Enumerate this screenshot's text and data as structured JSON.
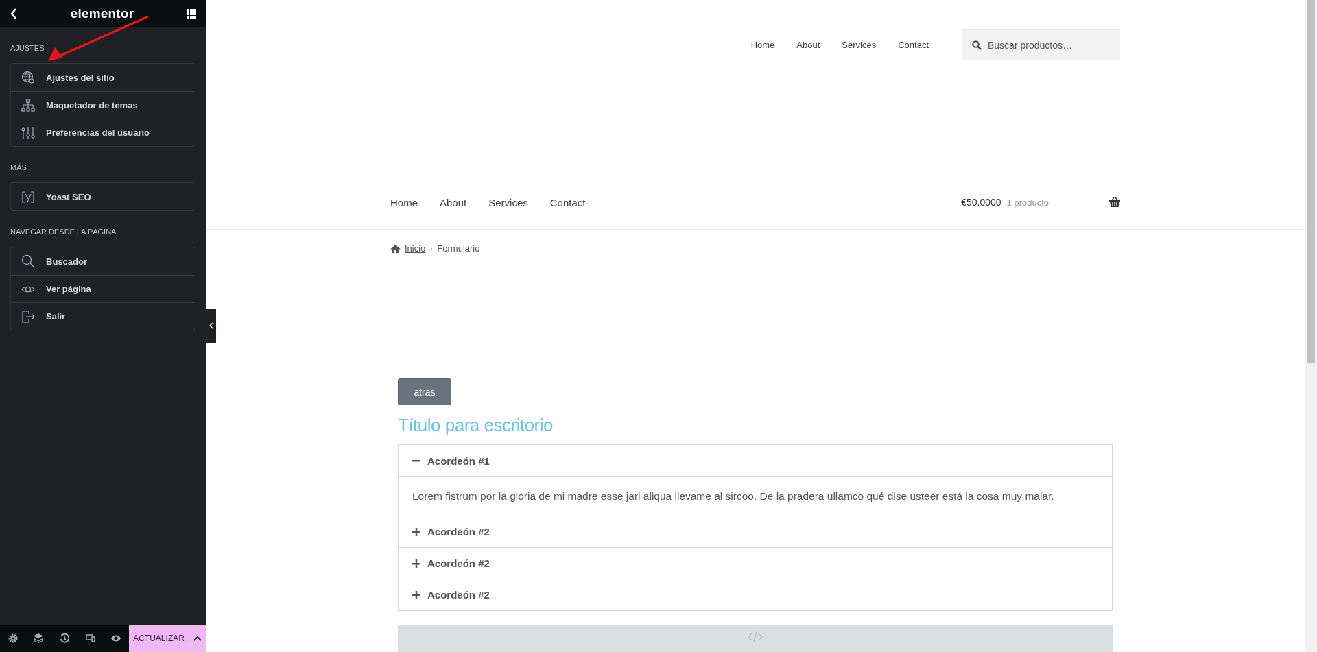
{
  "editor": {
    "logo": "elementor",
    "sections": [
      {
        "title": "AJUSTES",
        "items": [
          {
            "label": "Ajustes del sitio"
          },
          {
            "label": "Maquetador de temas"
          },
          {
            "label": "Preferencias del usuario"
          }
        ]
      },
      {
        "title": "MÁS",
        "items": [
          {
            "label": "Yoast SEO"
          }
        ]
      },
      {
        "title": "NAVEGAR DESDE LA PÁGINA",
        "items": [
          {
            "label": "Buscador"
          },
          {
            "label": "Ver página"
          },
          {
            "label": "Salir"
          }
        ]
      }
    ],
    "update_button": "ACTUALIZAR"
  },
  "site": {
    "top_nav": [
      "Home",
      "About",
      "Services",
      "Contact"
    ],
    "search": {
      "placeholder": "Buscar productos…"
    },
    "main_nav": [
      "Home",
      "About",
      "Services",
      "Contact"
    ],
    "cart": {
      "total": "€50.0000",
      "count": "1 producto"
    },
    "breadcrumb": [
      {
        "label": "Inicio",
        "link": true
      },
      {
        "label": "Formulario",
        "link": false
      }
    ],
    "back_button": "atras",
    "title": "Título para escritorio",
    "accordion": [
      {
        "title": "Acordeón #1",
        "expanded": true,
        "body": "Lorem fistrum por la gloria de mi madre esse jarl aliqua llevame al sircoo. De la pradera ullamco qué dise usteer está la cosa muy malar."
      },
      {
        "title": "Acordeón #2",
        "expanded": false
      },
      {
        "title": "Acordeón #2",
        "expanded": false
      },
      {
        "title": "Acordeón #2",
        "expanded": false
      }
    ]
  }
}
